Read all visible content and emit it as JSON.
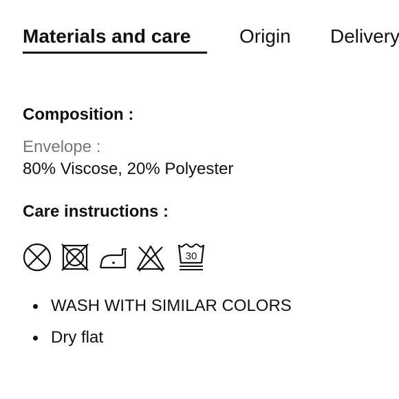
{
  "tabs": [
    {
      "label": "Materials and care",
      "active": true
    },
    {
      "label": "Origin",
      "active": false
    },
    {
      "label": "Delivery",
      "active": false
    }
  ],
  "composition": {
    "title": "Composition :",
    "part_label": "Envelope :",
    "part_value": "80% Viscose, 20% Polyester"
  },
  "care": {
    "title": "Care instructions :",
    "icons": [
      "do-not-dry-clean-icon",
      "do-not-tumble-dry-icon",
      "low-heat-iron-icon",
      "do-not-bleach-icon",
      "machine-wash-30-icon"
    ],
    "wash_temp_label": "30",
    "instructions": [
      "WASH WITH SIMILAR COLORS",
      "Dry flat"
    ]
  }
}
